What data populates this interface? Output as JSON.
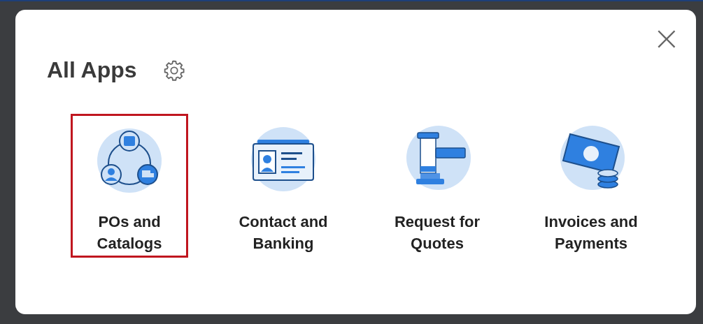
{
  "dialog": {
    "title": "All Apps",
    "close_label": "×"
  },
  "apps": [
    {
      "kind": "network",
      "label": "POs and Catalogs",
      "highlighted": true
    },
    {
      "kind": "id-card",
      "label": "Contact and Banking",
      "highlighted": false
    },
    {
      "kind": "gavel",
      "label": "Request for Quotes",
      "highlighted": false
    },
    {
      "kind": "money",
      "label": "Invoices and Payments",
      "highlighted": false
    }
  ]
}
